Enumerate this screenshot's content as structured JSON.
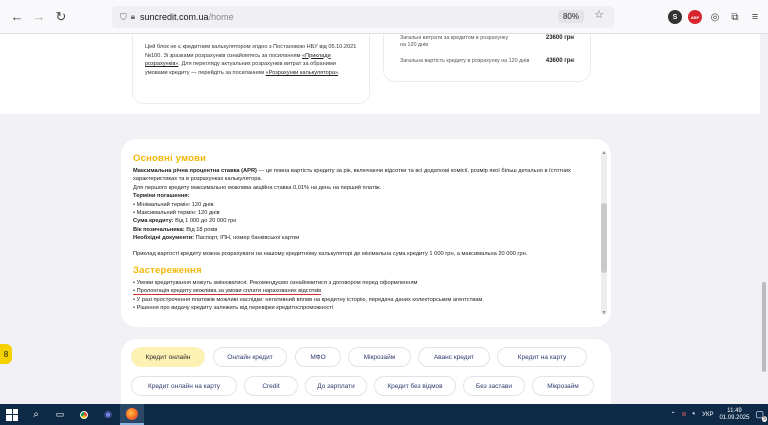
{
  "browser": {
    "url_domain": "suncredit.com.ua",
    "url_path": "/home",
    "zoom": "80%",
    "ext_badge": "S",
    "ext_badge2": "ABP"
  },
  "top_left_card": {
    "p1": "Цей блок не є кредитним калькулятором згідно з Постановою НБУ від 05.10.2021 №100. Зі зразками розрахунків ознайомтесь за посиланням",
    "link1": "«Приклади розрахунків»",
    "p2": ". Для перегляду актуальних розрахунків витрат за обраними умовами кредиту — перейдіть за посиланням",
    "link2": "«Розрахунки калькулятора»",
    "p3": "."
  },
  "top_right_card": {
    "row1_label": "Загальні витрати за кредитом в розрахунку на 120 днів",
    "row1_value": "23600 грн",
    "row2_label": "Загальна вартість кредиту в розрахунку на 120 днів",
    "row2_value": "43600 грн"
  },
  "conditions": {
    "title": "Основні умови",
    "apr_label": "Максимальна річна процентна ставка (APR)",
    "apr_text": " — це повна вартість кредиту за рік, включаючи відсотки та всі додаткові комісії, розмір якої більш детально в їстотних характеристиках та в розрахунках калькулятора.",
    "first_credit": "Для першого кредиту максимально можлива акційна ставка 0,01% на день на перший платіж.",
    "terms_label": "Терміни погашення:",
    "term_min": "• Мінімальний термін: 120 днів",
    "term_max": "• Максимальний термін: 120 днів",
    "sum_label": "Сума кредиту:",
    "sum_value": " Від 1 000 до 20 000 грн",
    "age_label": "Вік позичальника:",
    "age_value": " Від 18 років",
    "docs_label": "Необхідні документи:",
    "docs_value": " Паспорт, ІПН, номер банківської картки",
    "example": "Приклад вартості кредиту можна розрахувати на нашому кредитному калькуляторі де мінімальна сума кредиту 1 000 грн, а максимальна 20 000 грн."
  },
  "warning": {
    "title": "Застереження",
    "items": [
      "• Умови кредитування можуть змінюватися. Рекомендуємо ознайомитися з договором перед оформленням",
      "• Пролонгація кредиту можлива за умови сплати нарахованих відсотків",
      "• У разі прострочення платежів можливі наслідки: негативний вплив на кредитну історію, передача даних колекторським агентствам",
      "• Рішення про видачу кредиту залежить від перевірки кредитоспроможності"
    ]
  },
  "chips": [
    "Кредит онлайн",
    "Онлайн кредит",
    "МФО",
    "Мікрозайм",
    "Аванс кредит",
    "Кредит на карту",
    "Кредит онлайн на карту",
    "Credit",
    "До зарплати",
    "Кредит без відмов",
    "Без застави",
    "Мікрозайм"
  ],
  "yellow_tab_icon": "8",
  "taskbar": {
    "lang": "УКР",
    "time": "11:49",
    "date": "01.09.2025",
    "notif": "5"
  }
}
